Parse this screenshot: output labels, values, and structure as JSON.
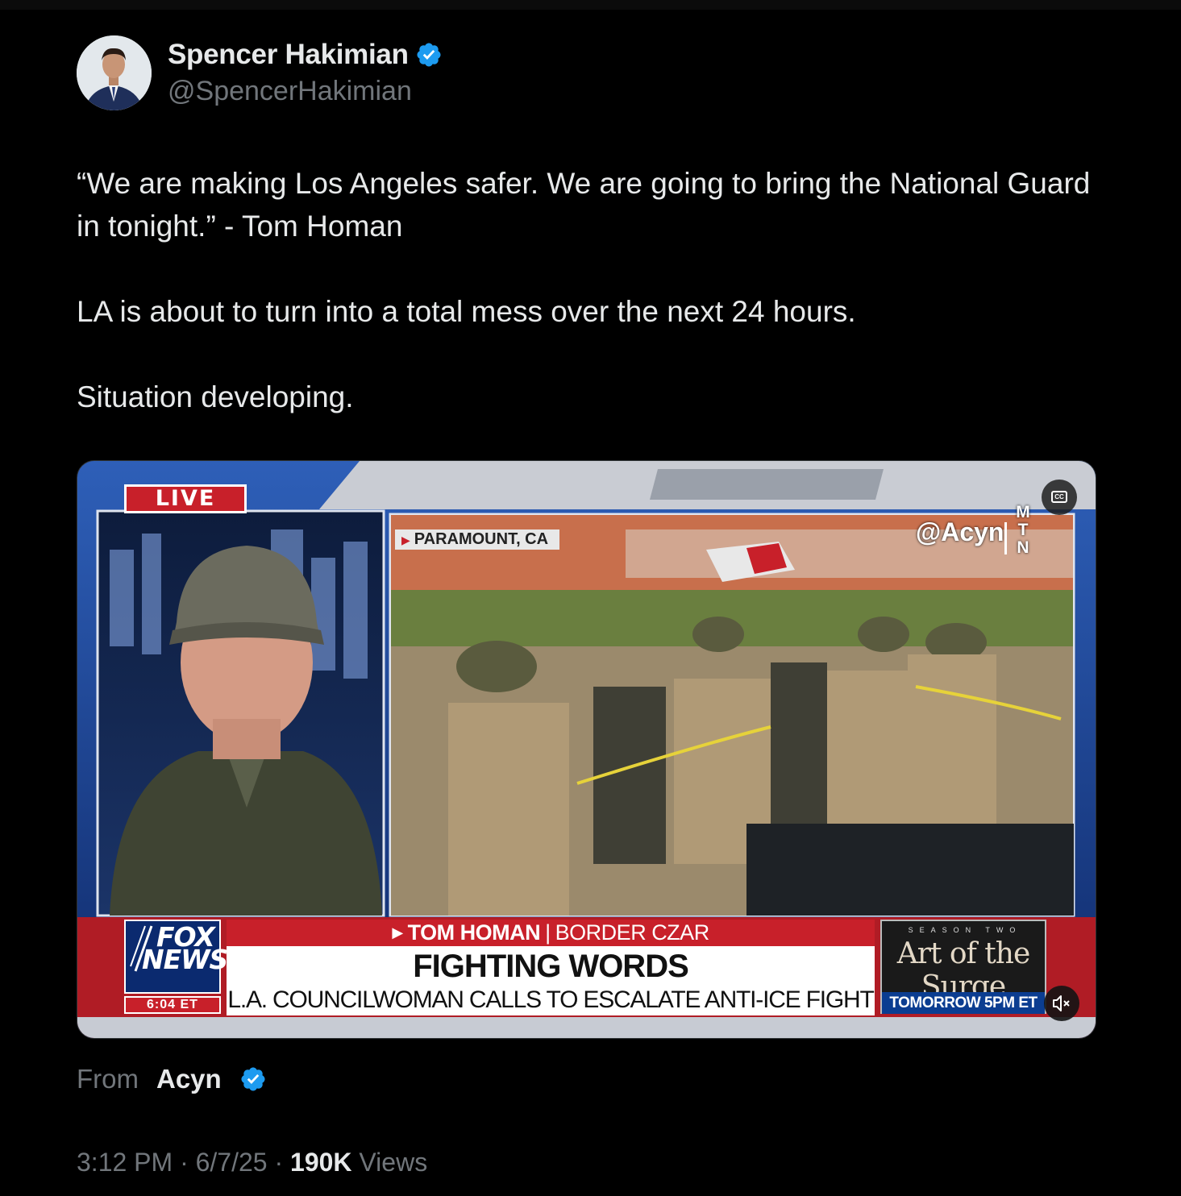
{
  "author": {
    "display_name": "Spencer Hakimian",
    "handle": "@SpencerHakimian",
    "verified": true,
    "avatar_icon": "profile-photo"
  },
  "tweet": {
    "paragraphs": [
      "“We are making Los Angeles safer. We are going to bring the National Guard in tonight.” - Tom Homan",
      "LA is about to turn into a total mess over the next 24 hours.",
      "Situation developing."
    ]
  },
  "media": {
    "live_badge": "LIVE",
    "location": "PARAMOUNT, CA",
    "watermark": "@Acyn",
    "watermark_mtn": [
      "M",
      "T",
      "N"
    ],
    "network_logo_line1": "FOX",
    "network_logo_line2": "NEWS",
    "network_time": "6:04 ET",
    "lower_third_name": "TOM HOMAN",
    "lower_third_role": "BORDER CZAR",
    "headline": "FIGHTING WORDS",
    "subheadline": "L.A. COUNCILWOMAN CALLS TO ESCALATE ANTI-ICE FIGHT",
    "promo_season": "SEASON TWO",
    "promo_title": "Art of the Surge",
    "promo_time": "TOMORROW 5PM ET",
    "cc_icon": "closed-captions-icon",
    "mute_icon": "speaker-muted-icon",
    "colors": {
      "fox_red": "#c8202a",
      "fox_blue": "#0b2a6f",
      "verified_blue": "#1d9bf0"
    }
  },
  "source": {
    "from_label": "From",
    "name": "Acyn",
    "verified": true
  },
  "meta": {
    "time": "3:12 PM",
    "date": "6/7/25",
    "views_count": "190K",
    "views_label": "Views"
  }
}
